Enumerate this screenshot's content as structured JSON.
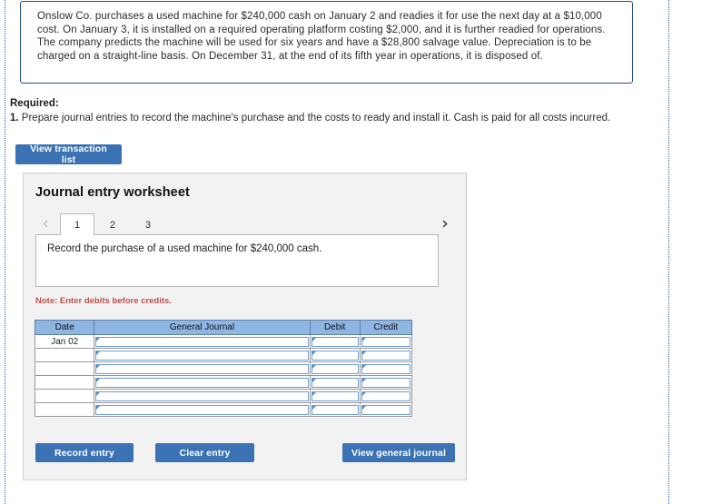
{
  "question": {
    "text": "Onslow Co. purchases a used machine for $240,000 cash on January 2 and readies it for use the next day at a $10,000 cost. On January 3, it is installed on a required operating platform costing $2,000, and it is further readied for operations. The company predicts the machine will be used for six years and have a $28,800 salvage value. Depreciation is to be charged on a straight-line basis. On December 31, at the end of its fifth year in operations, it is disposed of."
  },
  "required": {
    "label": "Required:",
    "number": "1.",
    "item": "Prepare journal entries to record the machine's purchase and the costs to ready and install it. Cash is paid for all costs incurred."
  },
  "toolbar": {
    "view_transaction_list": "View transaction list"
  },
  "worksheet": {
    "title": "Journal entry worksheet",
    "prev_icon": "‹",
    "next_icon": "›",
    "tabs": [
      {
        "label": "1",
        "active": true
      },
      {
        "label": "2",
        "active": false
      },
      {
        "label": "3",
        "active": false
      }
    ],
    "description": "Record the purchase of a used machine for $240,000 cash.",
    "note": "Note: Enter debits before credits.",
    "table": {
      "headers": [
        "Date",
        "General Journal",
        "Debit",
        "Credit"
      ],
      "rows": [
        {
          "date": "Jan 02",
          "account": "",
          "debit": "",
          "credit": ""
        },
        {
          "date": "",
          "account": "",
          "debit": "",
          "credit": ""
        },
        {
          "date": "",
          "account": "",
          "debit": "",
          "credit": ""
        },
        {
          "date": "",
          "account": "",
          "debit": "",
          "credit": ""
        },
        {
          "date": "",
          "account": "",
          "debit": "",
          "credit": ""
        },
        {
          "date": "",
          "account": "",
          "debit": "",
          "credit": ""
        }
      ]
    },
    "buttons": {
      "record_entry": "Record entry",
      "clear_entry": "Clear entry",
      "view_general_journal": "View general journal"
    }
  },
  "colors": {
    "button_blue": "#3a72b4",
    "table_header_blue": "#8fb6e3",
    "note_red": "#c0504d",
    "question_border": "#1f4e8c"
  }
}
